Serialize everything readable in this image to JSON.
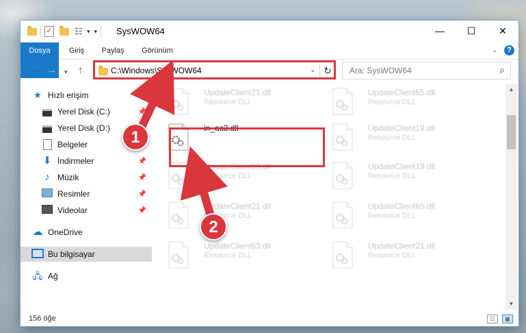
{
  "window": {
    "title": "SysWOW64",
    "controls": {
      "minimize": "—",
      "maximize": "☐",
      "close": "✕"
    }
  },
  "ribbon": {
    "tabs": [
      "Dosya",
      "Giriş",
      "Paylaş",
      "Görünüm"
    ],
    "help": "?"
  },
  "nav": {
    "address": "C:\\Windows\\SysWOW64",
    "search_placeholder": "Ara: SysWOW64"
  },
  "sidebar": {
    "items": [
      {
        "label": "Hızlı erişim",
        "icon": "star-icon"
      },
      {
        "label": "Yerel Disk (C:)",
        "icon": "drive-icon"
      },
      {
        "label": "Yerel Disk (D:)",
        "icon": "drive-icon"
      },
      {
        "label": "Belgeler",
        "icon": "document-icon"
      },
      {
        "label": "İndirmeler",
        "icon": "download-icon"
      },
      {
        "label": "Müzik",
        "icon": "music-icon"
      },
      {
        "label": "Resimler",
        "icon": "pictures-icon"
      },
      {
        "label": "Videolar",
        "icon": "video-icon"
      },
      {
        "label": "OneDrive",
        "icon": "cloud-icon"
      },
      {
        "label": "Bu bilgisayar",
        "icon": "computer-icon"
      },
      {
        "label": "Ağ",
        "icon": "network-icon"
      }
    ]
  },
  "files": [
    {
      "name": "UpdateClient21.dll",
      "type": "Resource DLL"
    },
    {
      "name": "UpdateClient65.dll",
      "type": "Resource DLL"
    },
    {
      "name": "in_ac3.dll",
      "type": ""
    },
    {
      "name": "UpdateClient19.dll",
      "type": "Resource DLL"
    },
    {
      "name": "UpdateClient63.dll",
      "type": "Resource DLL"
    },
    {
      "name": "UpdateClient19.dll",
      "type": "Resource DLL"
    },
    {
      "name": "UpdateClient21.dll",
      "type": "Resource DLL"
    },
    {
      "name": "UpdateClient65.dll",
      "type": "Resource DLL"
    },
    {
      "name": "UpdateClient63.dll",
      "type": "Resource DLL"
    },
    {
      "name": "UpdateClient21.dll",
      "type": "Resource DLL"
    }
  ],
  "status": {
    "count": "156 öğe"
  },
  "annotations": {
    "badge1": "1",
    "badge2": "2",
    "color": "#d9363e"
  }
}
